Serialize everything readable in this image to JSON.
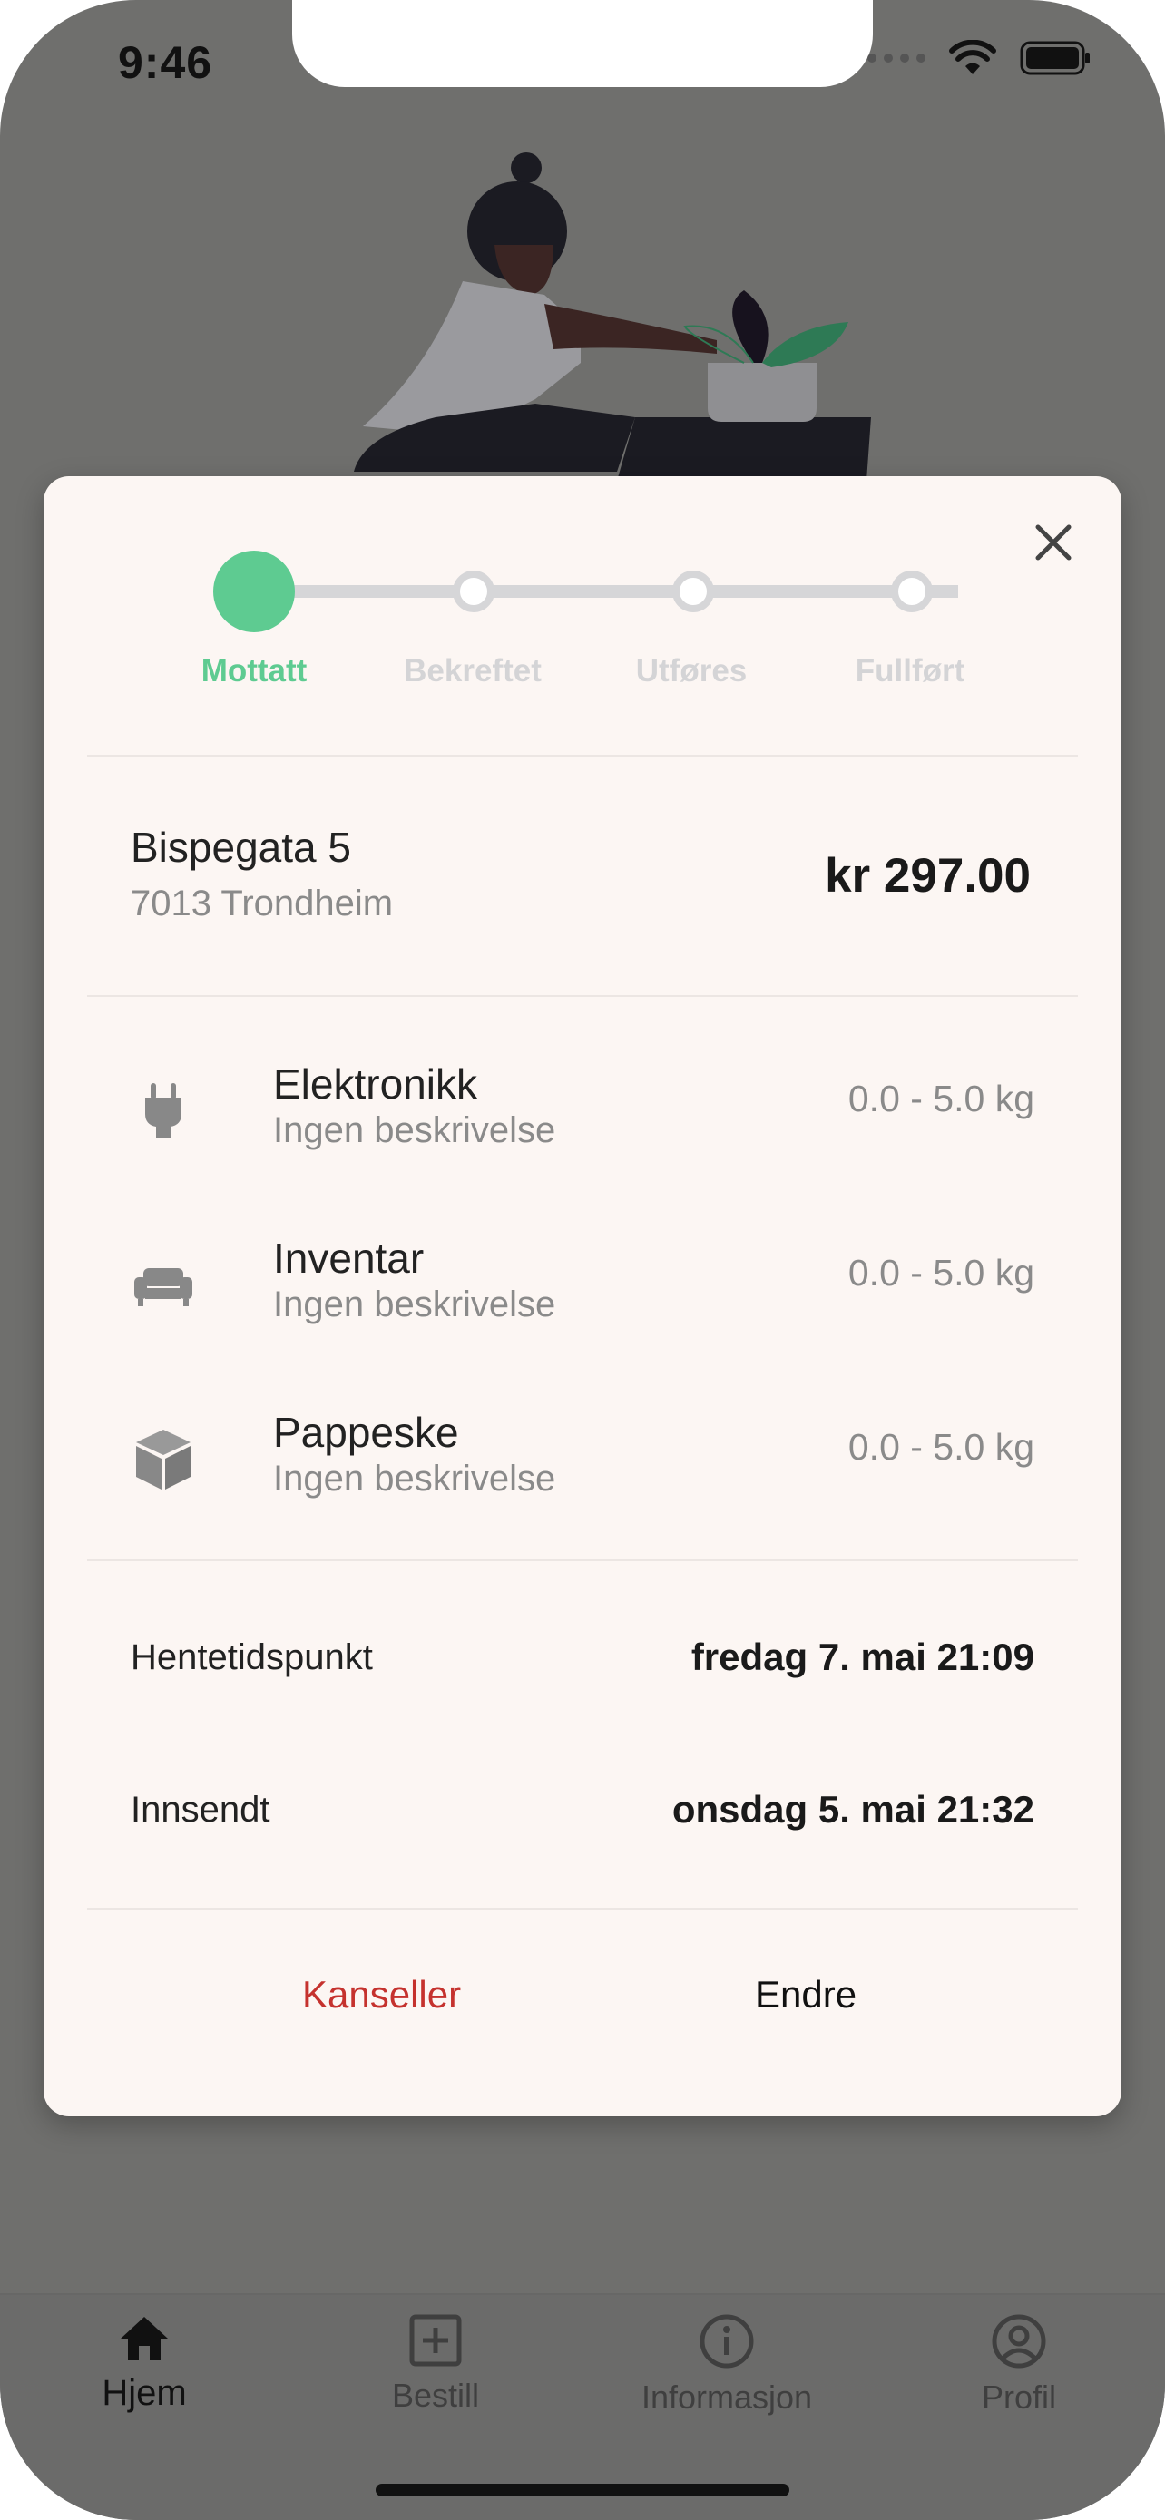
{
  "status_bar": {
    "time": "9:46"
  },
  "progress": {
    "steps": [
      {
        "label": "Mottatt",
        "active": true
      },
      {
        "label": "Bekreftet",
        "active": false
      },
      {
        "label": "Utføres",
        "active": false
      },
      {
        "label": "Fullført",
        "active": false
      }
    ],
    "active_color": "#5ecb91"
  },
  "address": {
    "line1": "Bispegata 5",
    "line2": "7013 Trondheim"
  },
  "price": "kr 297.00",
  "items": [
    {
      "icon": "plug-icon",
      "title": "Elektronikk",
      "description": "Ingen beskrivelse",
      "weight": "0.0 - 5.0 kg"
    },
    {
      "icon": "sofa-icon",
      "title": "Inventar",
      "description": "Ingen beskrivelse",
      "weight": "0.0 - 5.0 kg"
    },
    {
      "icon": "box-icon",
      "title": "Pappeske",
      "description": "Ingen beskrivelse",
      "weight": "0.0 - 5.0 kg"
    }
  ],
  "details": {
    "pickup_label": "Hentetidspunkt",
    "pickup_value": "fredag 7. mai 21:09",
    "submitted_label": "Innsendt",
    "submitted_value": "onsdag 5. mai 21:32"
  },
  "actions": {
    "cancel": "Kanseller",
    "edit": "Endre",
    "cancel_color": "#c5322e"
  },
  "tabs": [
    {
      "label": "Hjem",
      "icon": "home-icon",
      "active": true
    },
    {
      "label": "Bestill",
      "icon": "plus-square-icon",
      "active": false
    },
    {
      "label": "Informasjon",
      "icon": "info-icon",
      "active": false
    },
    {
      "label": "Profil",
      "icon": "profile-icon",
      "active": false
    }
  ]
}
